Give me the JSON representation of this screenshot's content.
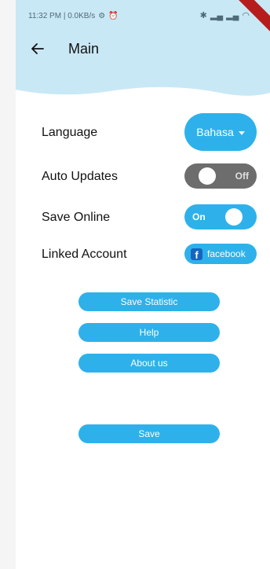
{
  "status_bar": {
    "time_text": "11:32 PM | 0.0KB/s",
    "icons": [
      "settings-icon",
      "alarm-icon",
      "bluetooth-icon",
      "signal-icon",
      "signal-icon",
      "wifi-icon",
      "battery-icon"
    ]
  },
  "app_bar": {
    "back_icon": "arrow-left-icon",
    "title": "Main"
  },
  "settings": {
    "language": {
      "label": "Language",
      "selected": "Bahasa"
    },
    "auto_updates": {
      "label": "Auto Updates",
      "state_text": "Off",
      "on": false
    },
    "save_online": {
      "label": "Save Online",
      "state_text": "On",
      "on": true
    },
    "linked_account": {
      "label": "Linked Account",
      "provider": "facebook"
    }
  },
  "buttons": {
    "save_statistic": "Save Statistic",
    "help": "Help",
    "about_us": "About us",
    "save": "Save"
  },
  "colors": {
    "accent": "#2eb1ea",
    "header_bg": "#c9e8f6",
    "toggle_off": "#6d6d6d",
    "facebook": "#1565c0"
  }
}
